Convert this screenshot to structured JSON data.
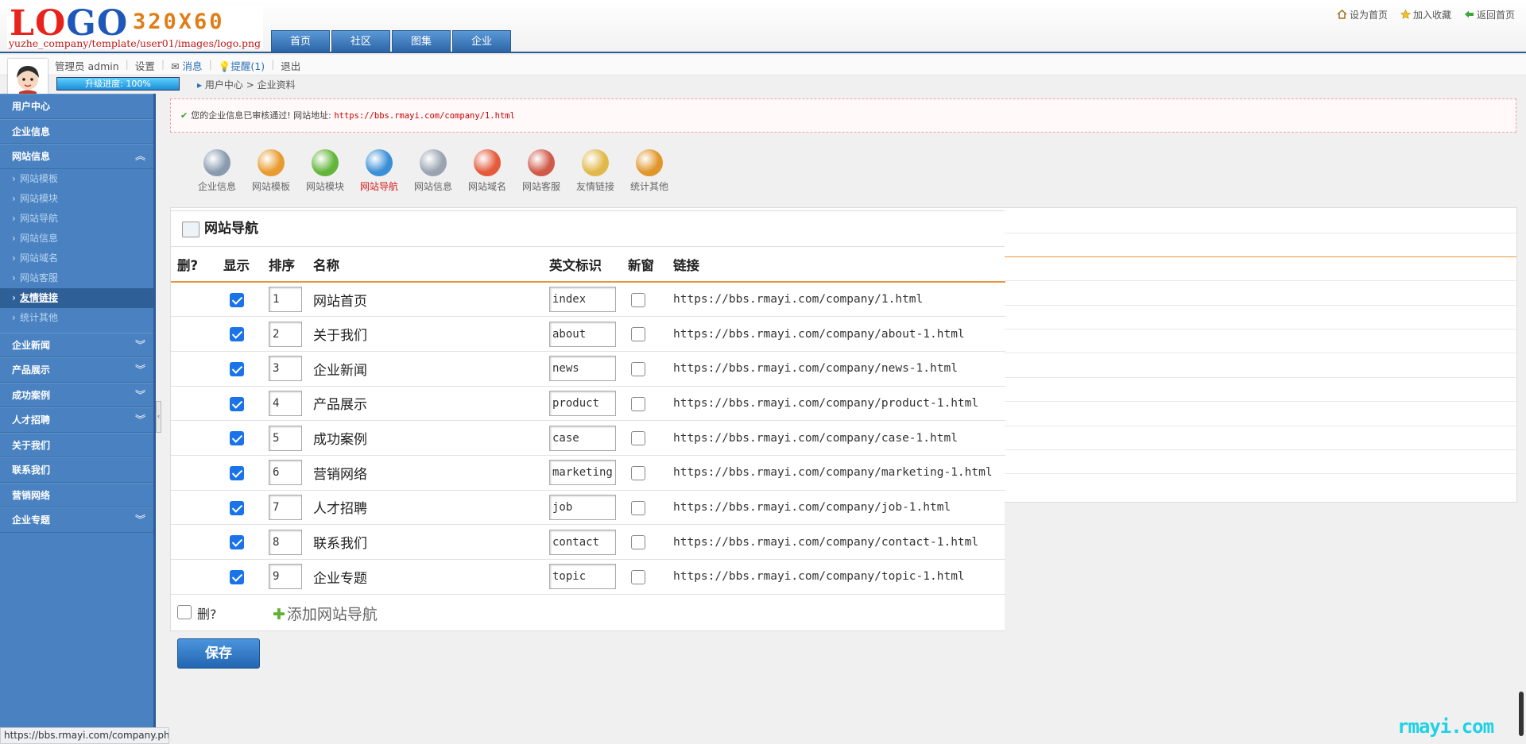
{
  "logo": {
    "main_left": "LO",
    "main_right": "GO",
    "size": "320X60",
    "path": "yuzhe_company/template/user01/images/logo.png"
  },
  "nav_tabs": [
    "首页",
    "社区",
    "图集",
    "企业"
  ],
  "top_links": [
    "设为首页",
    "加入收藏",
    "返回首页"
  ],
  "user": {
    "name": "管理员 admin",
    "settings": "设置",
    "messages": "消息",
    "reminders": "提醒(1)",
    "logout": "退出"
  },
  "progress": {
    "label": "升级进度: 100%",
    "value": 1.0
  },
  "breadcrumb": {
    "home": "用户中心",
    "current": "企业资料"
  },
  "sidebar": {
    "user_center": "用户中心",
    "company_info": "企业信息",
    "site_info": "网站信息",
    "site_info_items": [
      "网站模板",
      "网站模块",
      "网站导航",
      "网站信息",
      "网站域名",
      "网站客服",
      "友情链接",
      "统计其他"
    ],
    "active_index": 6,
    "sections": [
      "企业新闻",
      "产品展示",
      "成功案例",
      "人才招聘",
      "关于我们",
      "联系我们",
      "营销网络",
      "企业专题"
    ]
  },
  "notice": {
    "text": "您的企业信息已审核通过! 网站地址:",
    "url": "https://bbs.rmayi.com/company/1.html"
  },
  "toolbar_icons": [
    {
      "label": "企业信息",
      "icon": "gear-icon",
      "color": "#8a9bb0"
    },
    {
      "label": "网站模板",
      "icon": "pie-chart-icon",
      "color": "#e89b2e"
    },
    {
      "label": "网站模块",
      "icon": "puzzle-icon",
      "color": "#63b53a"
    },
    {
      "label": "网站导航",
      "icon": "globe-icon",
      "color": "#3a8fd6",
      "active": true
    },
    {
      "label": "网站信息",
      "icon": "document-icon",
      "color": "#9aa4b0"
    },
    {
      "label": "网站域名",
      "icon": "lifebuoy-icon",
      "color": "#e45a3a"
    },
    {
      "label": "网站客服",
      "icon": "users-icon",
      "color": "#d05a4a"
    },
    {
      "label": "友情链接",
      "icon": "gear-link-icon",
      "color": "#e0b94a"
    },
    {
      "label": "统计其他",
      "icon": "ruler-icon",
      "color": "#e0962a"
    }
  ],
  "panel": {
    "title": "网站导航"
  },
  "table": {
    "headers": [
      "删?",
      "显示",
      "排序",
      "名称",
      "英文标识",
      "新窗",
      "链接"
    ],
    "rows": [
      {
        "show": true,
        "order": "1",
        "name": "网站首页",
        "en": "index",
        "new_window": false,
        "link": "https://bbs.rmayi.com/company/1.html"
      },
      {
        "show": true,
        "order": "2",
        "name": "关于我们",
        "en": "about",
        "new_window": false,
        "link": "https://bbs.rmayi.com/company/about-1.html"
      },
      {
        "show": true,
        "order": "3",
        "name": "企业新闻",
        "en": "news",
        "new_window": false,
        "link": "https://bbs.rmayi.com/company/news-1.html"
      },
      {
        "show": true,
        "order": "4",
        "name": "产品展示",
        "en": "product",
        "new_window": false,
        "link": "https://bbs.rmayi.com/company/product-1.html"
      },
      {
        "show": true,
        "order": "5",
        "name": "成功案例",
        "en": "case",
        "new_window": false,
        "link": "https://bbs.rmayi.com/company/case-1.html"
      },
      {
        "show": true,
        "order": "6",
        "name": "营销网络",
        "en": "marketing",
        "new_window": false,
        "link": "https://bbs.rmayi.com/company/marketing-1.html"
      },
      {
        "show": true,
        "order": "7",
        "name": "人才招聘",
        "en": "job",
        "new_window": false,
        "link": "https://bbs.rmayi.com/company/job-1.html"
      },
      {
        "show": true,
        "order": "8",
        "name": "联系我们",
        "en": "contact",
        "new_window": false,
        "link": "https://bbs.rmayi.com/company/contact-1.html"
      },
      {
        "show": true,
        "order": "9",
        "name": "企业专题",
        "en": "topic",
        "new_window": false,
        "link": "https://bbs.rmayi.com/company/topic-1.html"
      }
    ],
    "footer_delete": "删?",
    "add_label": "添加网站导航"
  },
  "save_label": "保存",
  "status_url": "https://bbs.rmayi.com/company.php",
  "watermark": "rmayi.com"
}
